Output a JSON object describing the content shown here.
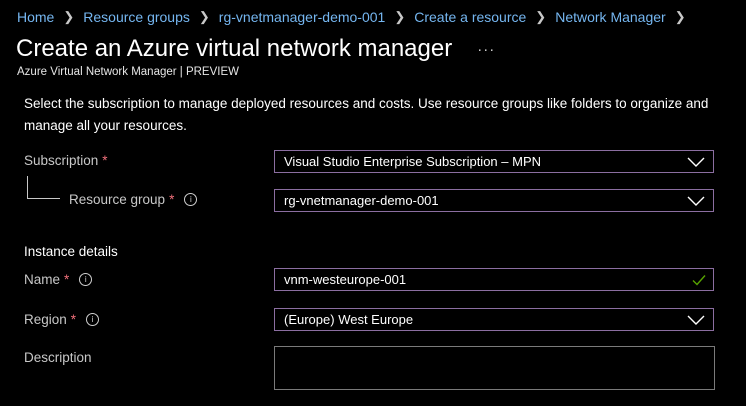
{
  "breadcrumb": [
    "Home",
    "Resource groups",
    "rg-vnetmanager-demo-001",
    "Create a resource",
    "Network Manager"
  ],
  "header": {
    "title": "Create an Azure virtual network manager",
    "more": "···",
    "subtitle": "Azure Virtual Network Manager | PREVIEW"
  },
  "intro": "Select the subscription to manage deployed resources and costs. Use resource groups like folders to organize and manage all your resources.",
  "form": {
    "subscription": {
      "label": "Subscription",
      "required": "*",
      "value": "Visual Studio Enterprise Subscription – MPN"
    },
    "resource_group": {
      "label": "Resource group",
      "required": "*",
      "info": "i",
      "value": "rg-vnetmanager-demo-001"
    },
    "instance_details": "Instance details",
    "name": {
      "label": "Name",
      "required": "*",
      "info": "i",
      "value": "vnm-westeurope-001"
    },
    "region": {
      "label": "Region",
      "required": "*",
      "info": "i",
      "value": "(Europe) West Europe"
    },
    "description": {
      "label": "Description",
      "value": ""
    }
  },
  "colors": {
    "link": "#75b6f0",
    "required": "#f1707b",
    "field_border": "#8b6ea1",
    "valid_check": "#57a300"
  },
  "icons": [
    "chevron-right-icon",
    "ellipsis-icon",
    "info-icon",
    "chevron-down-icon",
    "checkmark-icon"
  ]
}
